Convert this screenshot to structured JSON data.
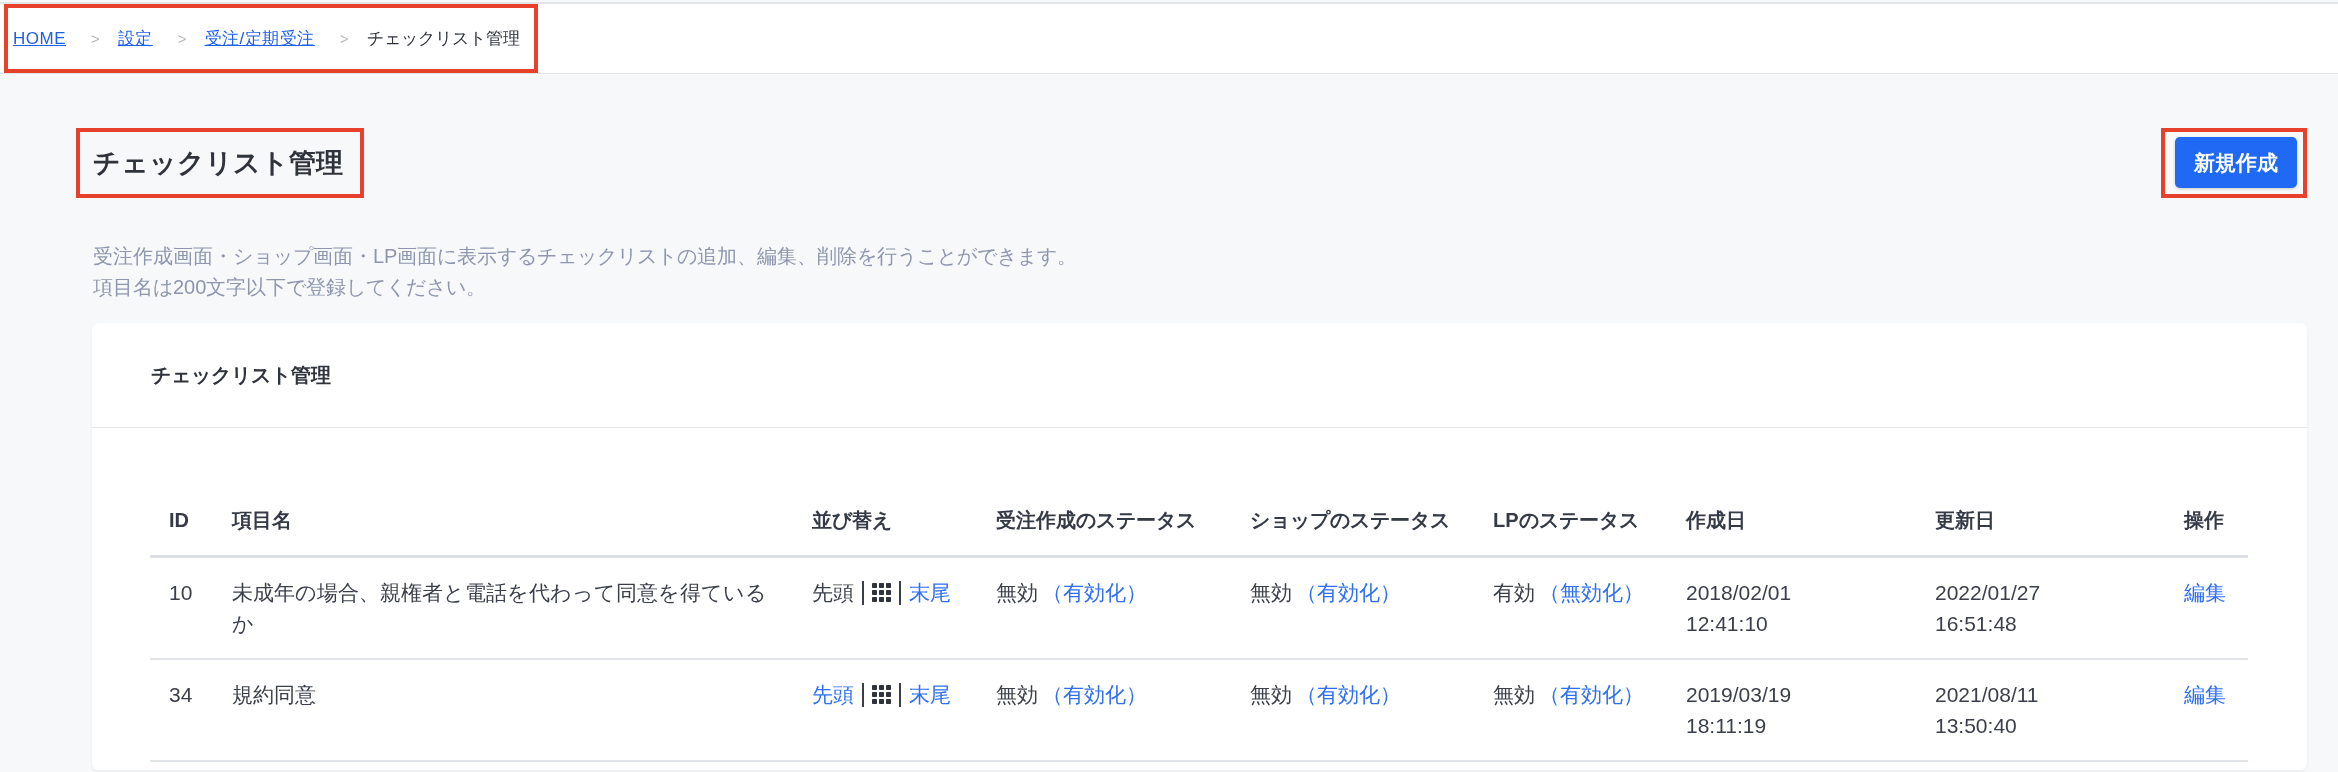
{
  "breadcrumb": {
    "highlighted": true,
    "items": [
      {
        "kind": "link",
        "label": "HOME"
      },
      {
        "kind": "link",
        "separator": ">",
        "label": "設定"
      },
      {
        "kind": "link",
        "separator": ">",
        "label": "受注/定期受注"
      },
      {
        "kind": "current",
        "separator": ">",
        "label": "チェックリスト管理"
      }
    ]
  },
  "page": {
    "title": {
      "text": "チェックリスト管理",
      "highlighted": true
    },
    "new_button": {
      "label": "新規作成",
      "highlighted": true
    },
    "description": [
      "受注作成画面・ショップ画面・LP画面に表示するチェックリストの追加、編集、削除を行うことができます。",
      "項目名は200文字以下で登録してください。"
    ]
  },
  "card": {
    "title": "チェックリスト管理",
    "columns": [
      "ID",
      "項目名",
      "並び替え",
      "受注作成のステータス",
      "ショップのステータス",
      "LPのステータス",
      "作成日",
      "更新日",
      "操作"
    ],
    "rows": [
      {
        "id": "10",
        "name": "未成年の場合、親権者と電話を代わって同意を得ているか",
        "reorder": {
          "first": {
            "label": "先頭",
            "disabled": true
          },
          "last": {
            "label": "末尾",
            "disabled": false
          }
        },
        "statuses": [
          {
            "value": "無効",
            "action": "（有効化）"
          },
          {
            "value": "無効",
            "action": "（有効化）"
          },
          {
            "value": "有効",
            "action": "（無効化）"
          }
        ],
        "created": "2018/02/01 12:41:10",
        "updated": "2022/01/27 16:51:48",
        "edit": "編集"
      },
      {
        "id": "34",
        "name": "規約同意",
        "reorder": {
          "first": {
            "label": "先頭",
            "disabled": false
          },
          "last": {
            "label": "末尾",
            "disabled": false
          }
        },
        "statuses": [
          {
            "value": "無効",
            "action": "（有効化）"
          },
          {
            "value": "無効",
            "action": "（有効化）"
          },
          {
            "value": "無効",
            "action": "（有効化）"
          }
        ],
        "created": "2019/03/19 18:11:19",
        "updated": "2021/08/11 13:50:40",
        "edit": "編集"
      }
    ]
  }
}
